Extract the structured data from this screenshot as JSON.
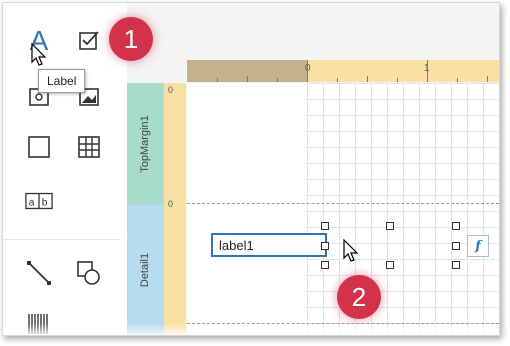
{
  "toolbox": {
    "items": [
      {
        "name": "label"
      },
      {
        "name": "checkbox"
      },
      {
        "name": "richtext"
      },
      {
        "name": "picture"
      },
      {
        "name": "panel"
      },
      {
        "name": "table"
      },
      {
        "name": "character-comb"
      },
      {
        "name": "line"
      },
      {
        "name": "shape"
      },
      {
        "name": "barcode"
      }
    ],
    "tooltip": "Label"
  },
  "steps": {
    "step1": "1",
    "step2": "2"
  },
  "ruler": {
    "zero": "0",
    "one": "1"
  },
  "bands": {
    "top_margin": "TopMargin1",
    "detail": "Detail1"
  },
  "control": {
    "text": "label1",
    "expression_glyph": "f"
  },
  "colors": {
    "accent": "#2e75b6",
    "badge": "#d2334a",
    "ruler": "#f8e1a3",
    "top_margin_band": "#a7dccc",
    "detail_band": "#b6dcee"
  }
}
